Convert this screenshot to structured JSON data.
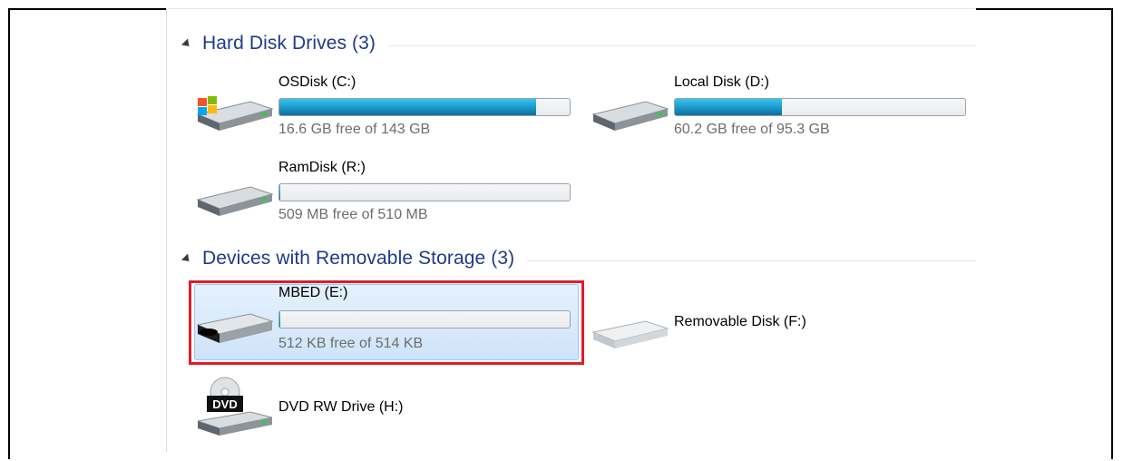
{
  "groups": [
    {
      "title": "Hard Disk Drives (3)",
      "drives": [
        {
          "name": "OSDisk (C:)",
          "free_text": "16.6 GB free of 143 GB",
          "used_fraction": 0.884,
          "icon": "windows-system-drive-icon"
        },
        {
          "name": "Local Disk (D:)",
          "free_text": "60.2 GB free of 95.3 GB",
          "used_fraction": 0.368,
          "icon": "hard-disk-icon"
        },
        {
          "name": "RamDisk (R:)",
          "free_text": "509 MB free of 510 MB",
          "used_fraction": 0.002,
          "icon": "hard-disk-icon"
        }
      ]
    },
    {
      "title": "Devices with Removable Storage (3)",
      "drives": [
        {
          "name": "MBED (E:)",
          "free_text": "512 KB free of 514 KB",
          "used_fraction": 0.004,
          "icon": "removable-drive-icon",
          "selected": true
        },
        {
          "name": "Removable Disk (F:)",
          "icon": "removable-drive-icon"
        },
        {
          "name": "DVD RW Drive (H:)",
          "icon": "dvd-drive-icon",
          "icon_label": "DVD"
        }
      ]
    }
  ],
  "colors": {
    "group_title": "#1e3a8a",
    "bar_fill": "#1f9fd2",
    "highlight_border": "#e01b2a",
    "selection": "#cfe4f9"
  }
}
